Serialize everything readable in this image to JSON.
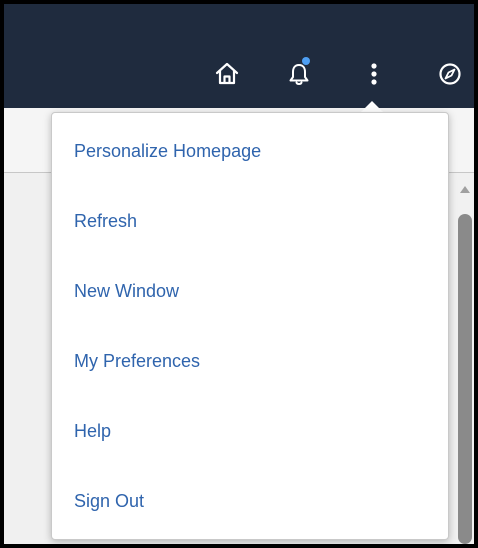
{
  "header": {
    "icons": [
      {
        "name": "home-icon"
      },
      {
        "name": "notifications-icon",
        "has_badge": true
      },
      {
        "name": "actions-menu-icon"
      },
      {
        "name": "navbar-icon"
      }
    ],
    "badge_color": "#4e9ff3",
    "bar_color": "#1f2b3e"
  },
  "actions_menu": {
    "items": [
      {
        "label": "Personalize Homepage"
      },
      {
        "label": "Refresh"
      },
      {
        "label": "New Window"
      },
      {
        "label": "My Preferences"
      },
      {
        "label": "Help"
      },
      {
        "label": "Sign Out"
      }
    ],
    "link_color": "#2f64ad"
  }
}
